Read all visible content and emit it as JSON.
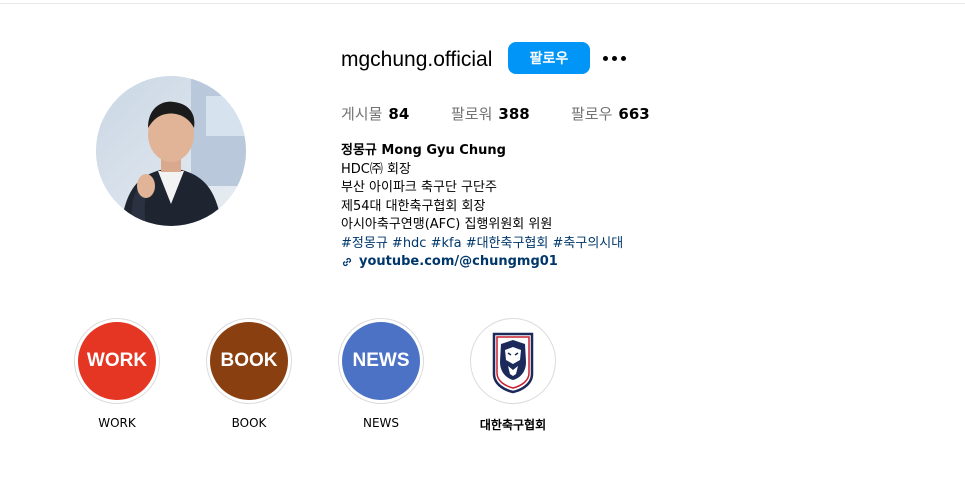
{
  "profile": {
    "username": "mgchung.official",
    "follow_label": "팔로우",
    "stats": {
      "posts_label": "게시물",
      "posts_count": "84",
      "followers_label": "팔로워",
      "followers_count": "388",
      "following_label": "팔로우",
      "following_count": "663"
    },
    "bio": {
      "name": "정몽규 Mong Gyu Chung",
      "lines": [
        "HDC㈜ 회장",
        "부산 아이파크 축구단 구단주",
        "제54대 대한축구협회 회장",
        "아시아축구연맹(AFC) 집행위원회 위원"
      ],
      "hashtags": [
        "#정몽규",
        "#hdc",
        "#kfa",
        "#대한축구협회",
        "#축구의시대"
      ],
      "link": "youtube.com/@chungmg01"
    }
  },
  "highlights": [
    {
      "cover_text": "WORK",
      "label": "WORK",
      "color": "#e53523"
    },
    {
      "cover_text": "BOOK",
      "label": "BOOK",
      "color": "#8a3f10"
    },
    {
      "cover_text": "NEWS",
      "label": "NEWS",
      "color": "#4b72c4"
    },
    {
      "cover_text": "",
      "label": "대한축구협회",
      "color": "#ffffff"
    }
  ],
  "colors": {
    "accent": "#0095f6",
    "link": "#00376b",
    "muted": "#737373"
  },
  "icons": {
    "more": "more-options-icon",
    "link": "link-icon",
    "kfa": "kfa-tiger-emblem-icon"
  }
}
